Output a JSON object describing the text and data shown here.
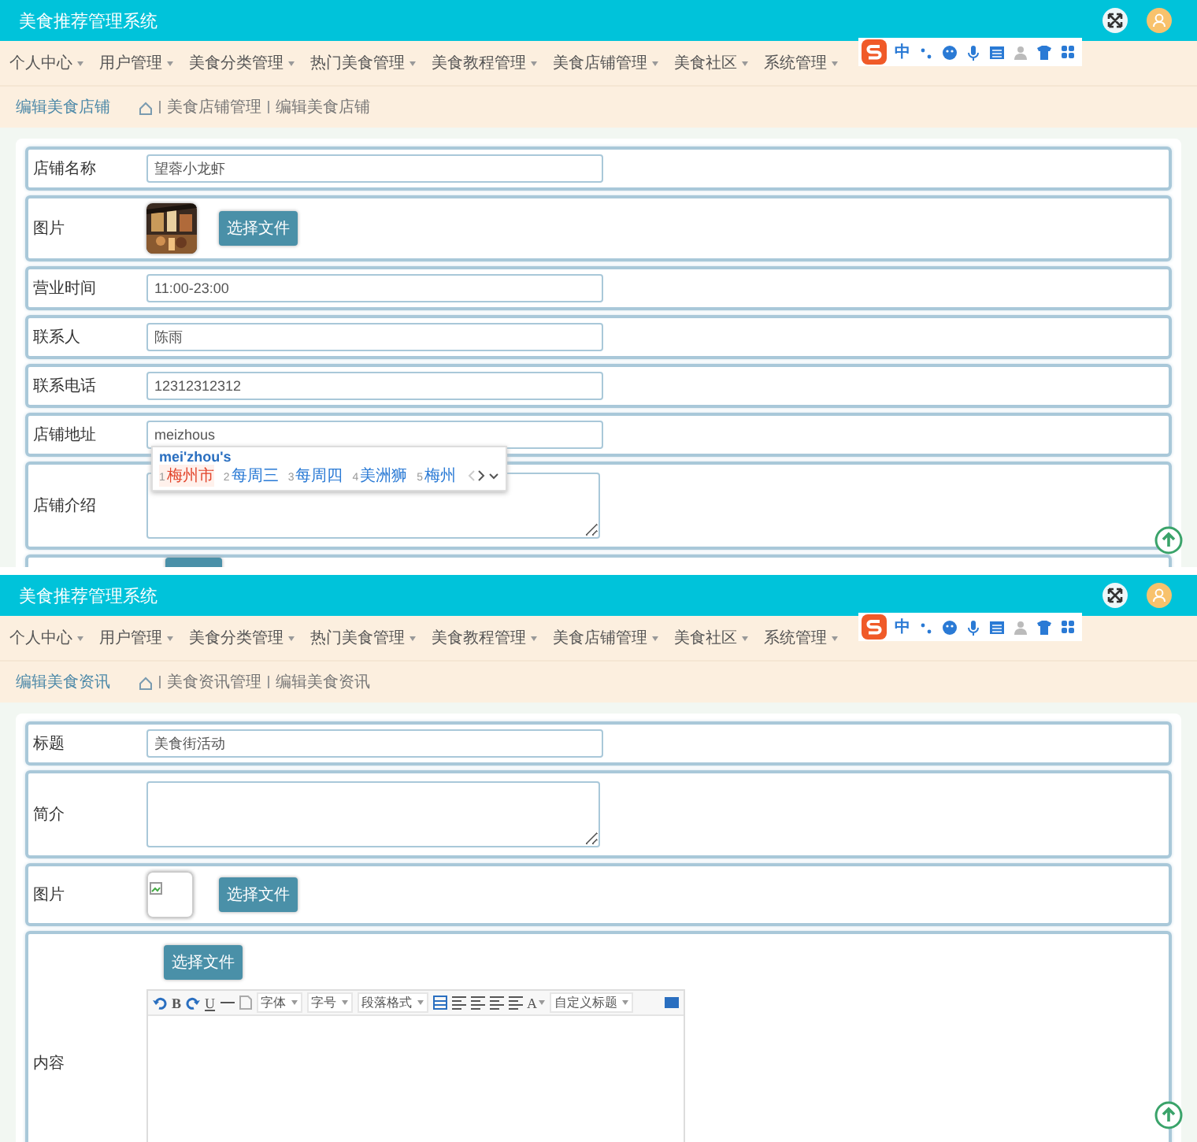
{
  "screens": [
    {
      "header": {
        "title": "美食推荐管理系统"
      },
      "nav": [
        {
          "label": "个人中心"
        },
        {
          "label": "用户管理"
        },
        {
          "label": "美食分类管理"
        },
        {
          "label": "热门美食管理"
        },
        {
          "label": "美食教程管理"
        },
        {
          "label": "美食店铺管理"
        },
        {
          "label": "美食社区"
        },
        {
          "label": "系统管理"
        }
      ],
      "breadcrumb": {
        "page_title": "编辑美食店铺",
        "path": [
          "美食店铺管理",
          "编辑美食店铺"
        ]
      },
      "ime_toolbar": {
        "mode": "中"
      },
      "form": {
        "rows": [
          {
            "kind": "text",
            "label": "店铺名称",
            "value": "望蓉小龙虾"
          },
          {
            "kind": "image_photo",
            "label": "图片",
            "button": "选择文件"
          },
          {
            "kind": "text",
            "label": "营业时间",
            "value": "11:00-23:00"
          },
          {
            "kind": "text",
            "label": "联系人",
            "value": "陈雨"
          },
          {
            "kind": "text",
            "label": "联系电话",
            "value": "12312312312"
          },
          {
            "kind": "text",
            "label": "店铺地址",
            "value": "meizhous"
          },
          {
            "kind": "textarea",
            "label": "店铺介绍",
            "value": ""
          },
          {
            "kind": "cut"
          }
        ]
      },
      "ime_popup": {
        "pinyin": "mei'zhou's",
        "candidates": [
          {
            "number": "1",
            "text": "梅州市",
            "selected": true
          },
          {
            "number": "2",
            "text": "每周三",
            "selected": false
          },
          {
            "number": "3",
            "text": "每周四",
            "selected": false
          },
          {
            "number": "4",
            "text": "美洲狮",
            "selected": false
          },
          {
            "number": "5",
            "text": "梅州",
            "selected": false
          }
        ]
      }
    },
    {
      "header": {
        "title": "美食推荐管理系统"
      },
      "nav": [
        {
          "label": "个人中心"
        },
        {
          "label": "用户管理"
        },
        {
          "label": "美食分类管理"
        },
        {
          "label": "热门美食管理"
        },
        {
          "label": "美食教程管理"
        },
        {
          "label": "美食店铺管理"
        },
        {
          "label": "美食社区"
        },
        {
          "label": "系统管理"
        }
      ],
      "breadcrumb": {
        "page_title": "编辑美食资讯",
        "path": [
          "美食资讯管理",
          "编辑美食资讯"
        ]
      },
      "ime_toolbar": {
        "mode": "中"
      },
      "form": {
        "rows": [
          {
            "kind": "text",
            "label": "标题",
            "value": "美食街活动"
          },
          {
            "kind": "textarea",
            "label": "简介",
            "value": ""
          },
          {
            "kind": "image_broken",
            "label": "图片",
            "button": "选择文件"
          },
          {
            "kind": "editor",
            "label": "内容",
            "button": "选择文件",
            "toolbar": [
              {
                "kind": "undo"
              },
              {
                "kind": "bold",
                "text": "B"
              },
              {
                "kind": "redo"
              },
              {
                "kind": "underline",
                "text": "U"
              },
              {
                "kind": "rule"
              },
              {
                "kind": "page"
              },
              {
                "kind": "select",
                "text": "字体"
              },
              {
                "kind": "select",
                "text": "字号"
              },
              {
                "kind": "select",
                "text": "段落格式"
              },
              {
                "kind": "table"
              },
              {
                "kind": "align"
              },
              {
                "kind": "align"
              },
              {
                "kind": "align"
              },
              {
                "kind": "align"
              },
              {
                "kind": "color",
                "text": "A"
              },
              {
                "kind": "select",
                "text": "自定义标题"
              },
              {
                "kind": "fullscreen"
              }
            ]
          }
        ]
      }
    }
  ]
}
